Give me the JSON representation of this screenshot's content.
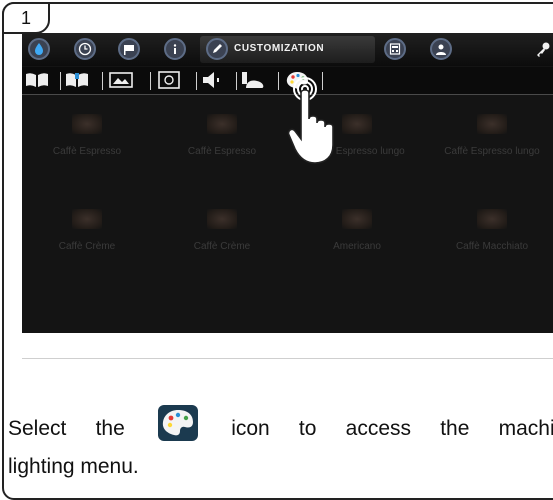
{
  "step": {
    "number": "1"
  },
  "screen": {
    "tabs": [
      {
        "icon": "water-drop-icon"
      },
      {
        "icon": "clock-icon"
      },
      {
        "icon": "flag-icon"
      },
      {
        "icon": "info-icon"
      },
      {
        "icon": "pencil-icon",
        "label": "CUSTOMIZATION"
      },
      {
        "icon": "calculator-icon"
      },
      {
        "icon": "user-icon"
      },
      {
        "icon": "key-icon"
      }
    ],
    "subtabs": [
      {
        "icon": "book-icon"
      },
      {
        "icon": "book-open-icon"
      },
      {
        "icon": "display-icon"
      },
      {
        "icon": "monitor-icon"
      },
      {
        "icon": "speaker-icon"
      },
      {
        "icon": "eco-icon"
      },
      {
        "icon": "palette-icon"
      }
    ],
    "drinks": [
      "Caffè Espresso",
      "Caffè Espresso",
      "Caffè Espresso lungo",
      "Caffè Espresso lungo",
      "Caffè Crème",
      "Caffè Crème",
      "Americano",
      "Caffè Macchiato"
    ]
  },
  "caption": {
    "line1_before": "Select the",
    "line1_after": "icon to access the machine",
    "line2": "lighting menu."
  },
  "colors": {
    "accent": "#2a8fd6",
    "screen_bg": "#141414"
  }
}
